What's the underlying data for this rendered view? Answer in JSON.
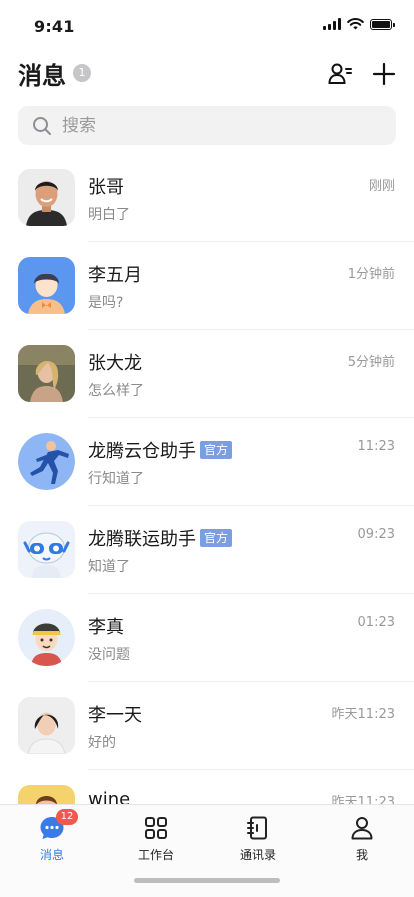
{
  "status_bar": {
    "time": "9:41"
  },
  "header": {
    "title": "消息",
    "count": "1",
    "contacts_icon": "user-settings-icon",
    "add_icon": "plus-icon"
  },
  "search": {
    "placeholder": "搜索",
    "icon": "search-icon"
  },
  "conversations": [
    {
      "name": "张哥",
      "time": "刚刚",
      "message": "明白了",
      "tag": ""
    },
    {
      "name": "李五月",
      "time": "1分钟前",
      "message": "是吗?",
      "tag": ""
    },
    {
      "name": "张大龙",
      "time": "5分钟前",
      "message": "怎么样了",
      "tag": ""
    },
    {
      "name": "龙腾云仓助手",
      "time": "11:23",
      "message": "行知道了",
      "tag": "官方"
    },
    {
      "name": "龙腾联运助手",
      "time": "09:23",
      "message": "知道了",
      "tag": "官方"
    },
    {
      "name": "李真",
      "time": "01:23",
      "message": "没问题",
      "tag": ""
    },
    {
      "name": "李一天",
      "time": "昨天11:23",
      "message": "好的",
      "tag": ""
    },
    {
      "name": "wine",
      "time": "昨天11:23",
      "message": "",
      "tag": ""
    }
  ],
  "tabbar": {
    "items": [
      {
        "label": "消息",
        "icon": "chat-icon",
        "badge": "12",
        "active": true
      },
      {
        "label": "工作台",
        "icon": "grid-icon"
      },
      {
        "label": "通讯录",
        "icon": "address-book-icon"
      },
      {
        "label": "我",
        "icon": "person-icon"
      }
    ]
  },
  "colors": {
    "accent": "#3a7be8",
    "badge": "#f2584e",
    "official_tag": "#7a9fe0"
  }
}
